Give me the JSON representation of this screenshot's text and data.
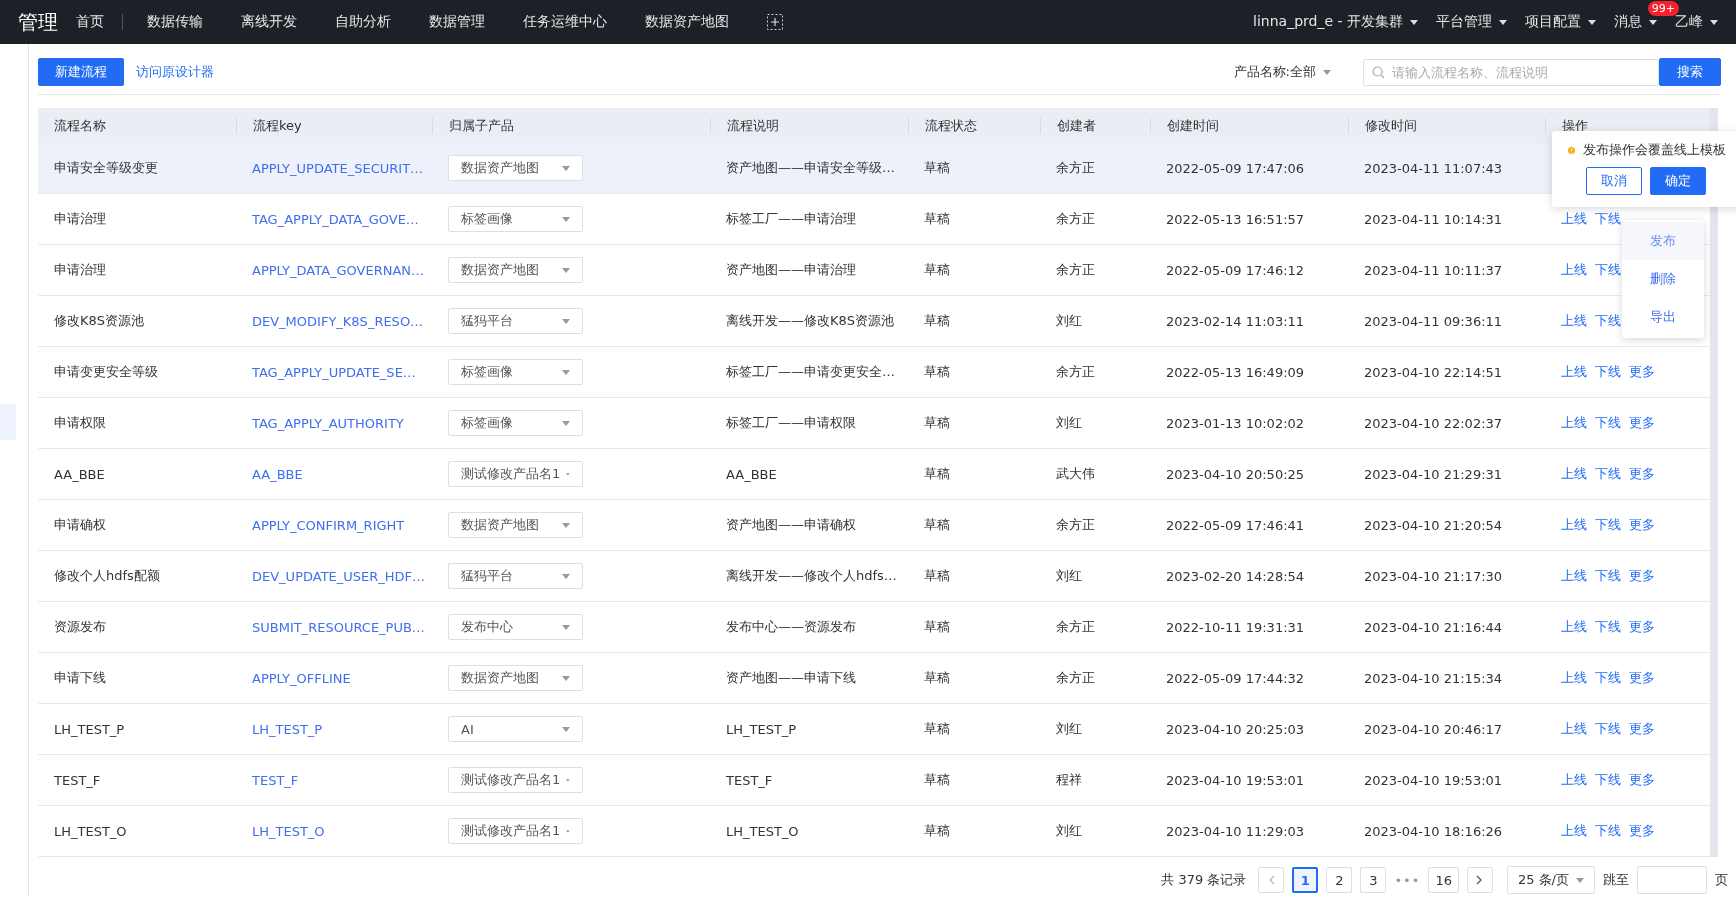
{
  "topbar": {
    "title": "管理",
    "nav": [
      {
        "label": "首页"
      },
      {
        "label": "数据传输"
      },
      {
        "label": "离线开发"
      },
      {
        "label": "自助分析"
      },
      {
        "label": "数据管理"
      },
      {
        "label": "任务运维中心"
      },
      {
        "label": "数据资产地图"
      }
    ],
    "right_menus": [
      {
        "label": "linna_prd_e - 开发集群"
      },
      {
        "label": "平台管理"
      },
      {
        "label": "项目配置"
      },
      {
        "label": "消息",
        "badge": "99+"
      },
      {
        "label": "乙峰"
      }
    ]
  },
  "toolbar": {
    "new_button": "新建流程",
    "designer_link": "访问原设计器",
    "product_filter": "产品名称:全部",
    "search": {
      "placeholder": "请输入流程名称、流程说明"
    },
    "search_button": "搜索"
  },
  "table": {
    "columns": [
      "流程名称",
      "流程key",
      "归属子产品",
      "流程说明",
      "流程状态",
      "创建者",
      "创建时间",
      "修改时间",
      "操作"
    ],
    "rows": [
      {
        "name": "申请安全等级变更",
        "key": "APPLY_UPDATE_SECURIT…",
        "product": "数据资产地图",
        "desc": "资产地图——申请安全等级…",
        "status": "草稿",
        "creator": "余方正",
        "created": "2022-05-09 17:47:06",
        "modified": "2023-04-11 11:07:43",
        "actions": [],
        "highlighted": true
      },
      {
        "name": "申请治理",
        "key": "TAG_APPLY_DATA_GOVE…",
        "product": "标签画像",
        "desc": "标签工厂——申请治理",
        "status": "草稿",
        "creator": "余方正",
        "created": "2022-05-13 16:51:57",
        "modified": "2023-04-11 10:14:31",
        "actions": [
          "上线",
          "下线"
        ],
        "highlighted": false
      },
      {
        "name": "申请治理",
        "key": "APPLY_DATA_GOVERNAN…",
        "product": "数据资产地图",
        "desc": "资产地图——申请治理",
        "status": "草稿",
        "creator": "余方正",
        "created": "2022-05-09 17:46:12",
        "modified": "2023-04-11 10:11:37",
        "actions": [
          "上线",
          "下线"
        ],
        "highlighted": false
      },
      {
        "name": "修改K8S资源池",
        "key": "DEV_MODIFY_K8S_RESO…",
        "product": "猛犸平台",
        "desc": "离线开发——修改K8S资源池",
        "status": "草稿",
        "creator": "刘红",
        "created": "2023-02-14 11:03:11",
        "modified": "2023-04-11 09:36:11",
        "actions": [
          "上线",
          "下线"
        ],
        "highlighted": false
      },
      {
        "name": "申请变更安全等级",
        "key": "TAG_APPLY_UPDATE_SE…",
        "product": "标签画像",
        "desc": "标签工厂——申请变更安全…",
        "status": "草稿",
        "creator": "余方正",
        "created": "2022-05-13 16:49:09",
        "modified": "2023-04-10 22:14:51",
        "actions": [
          "上线",
          "下线",
          "更多"
        ],
        "highlighted": false
      },
      {
        "name": "申请权限",
        "key": "TAG_APPLY_AUTHORITY",
        "product": "标签画像",
        "desc": "标签工厂——申请权限",
        "status": "草稿",
        "creator": "刘红",
        "created": "2023-01-13 10:02:02",
        "modified": "2023-04-10 22:02:37",
        "actions": [
          "上线",
          "下线",
          "更多"
        ],
        "highlighted": false
      },
      {
        "name": "AA_BBE",
        "key": "AA_BBE",
        "product": "测试修改产品名1",
        "desc": "AA_BBE",
        "status": "草稿",
        "creator": "武大伟",
        "created": "2023-04-10 20:50:25",
        "modified": "2023-04-10 21:29:31",
        "actions": [
          "上线",
          "下线",
          "更多"
        ],
        "highlighted": false
      },
      {
        "name": "申请确权",
        "key": "APPLY_CONFIRM_RIGHT",
        "product": "数据资产地图",
        "desc": "资产地图——申请确权",
        "status": "草稿",
        "creator": "余方正",
        "created": "2022-05-09 17:46:41",
        "modified": "2023-04-10 21:20:54",
        "actions": [
          "上线",
          "下线",
          "更多"
        ],
        "highlighted": false
      },
      {
        "name": "修改个人hdfs配额",
        "key": "DEV_UPDATE_USER_HDF…",
        "product": "猛犸平台",
        "desc": "离线开发——修改个人hdfs…",
        "status": "草稿",
        "creator": "刘红",
        "created": "2023-02-20 14:28:54",
        "modified": "2023-04-10 21:17:30",
        "actions": [
          "上线",
          "下线",
          "更多"
        ],
        "highlighted": false
      },
      {
        "name": "资源发布",
        "key": "SUBMIT_RESOURCE_PUB…",
        "product": "发布中心",
        "desc": "发布中心——资源发布",
        "status": "草稿",
        "creator": "余方正",
        "created": "2022-10-11 19:31:31",
        "modified": "2023-04-10 21:16:44",
        "actions": [
          "上线",
          "下线",
          "更多"
        ],
        "highlighted": false
      },
      {
        "name": "申请下线",
        "key": "APPLY_OFFLINE",
        "product": "数据资产地图",
        "desc": "资产地图——申请下线",
        "status": "草稿",
        "creator": "余方正",
        "created": "2022-05-09 17:44:32",
        "modified": "2023-04-10 21:15:34",
        "actions": [
          "上线",
          "下线",
          "更多"
        ],
        "highlighted": false
      },
      {
        "name": "LH_TEST_P",
        "key": "LH_TEST_P",
        "product": "AI",
        "desc": "LH_TEST_P",
        "status": "草稿",
        "creator": "刘红",
        "created": "2023-04-10 20:25:03",
        "modified": "2023-04-10 20:46:17",
        "actions": [
          "上线",
          "下线",
          "更多"
        ],
        "highlighted": false
      },
      {
        "name": "TEST_F",
        "key": "TEST_F",
        "product": "测试修改产品名1",
        "desc": "TEST_F",
        "status": "草稿",
        "creator": "程祥",
        "created": "2023-04-10 19:53:01",
        "modified": "2023-04-10 19:53:01",
        "actions": [
          "上线",
          "下线",
          "更多"
        ],
        "highlighted": false
      },
      {
        "name": "LH_TEST_O",
        "key": "LH_TEST_O",
        "product": "测试修改产品名1",
        "desc": "LH_TEST_O",
        "status": "草稿",
        "creator": "刘红",
        "created": "2023-04-10 11:29:03",
        "modified": "2023-04-10 18:16:26",
        "actions": [
          "上线",
          "下线",
          "更多"
        ],
        "highlighted": false
      }
    ]
  },
  "popconfirm": {
    "message": "发布操作会覆盖线上模板",
    "cancel": "取消",
    "confirm": "确定"
  },
  "more_menu": [
    {
      "label": "发布",
      "selected": true
    },
    {
      "label": "删除",
      "selected": false
    },
    {
      "label": "导出",
      "selected": false
    }
  ],
  "pagination": {
    "total": "共 379 条记录",
    "pages": [
      {
        "label": "1",
        "kind": "page",
        "selected": true
      },
      {
        "label": "2",
        "kind": "page",
        "selected": false
      },
      {
        "label": "3",
        "kind": "page",
        "selected": false
      },
      {
        "label": "•••",
        "kind": "ellipsis",
        "selected": false
      },
      {
        "label": "16",
        "kind": "page",
        "selected": false
      }
    ],
    "page_size": "25 条/页",
    "jump_label": "跳至",
    "jump_suffix": "页"
  }
}
